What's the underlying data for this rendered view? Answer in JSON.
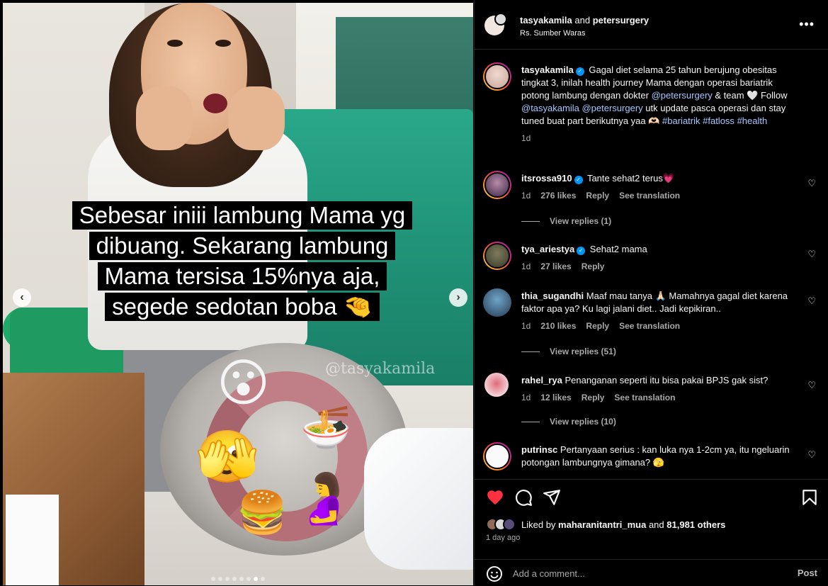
{
  "post": {
    "caption_lines": [
      "Sebesar iniii lambung Mama yg",
      "dibuang. Sekarang lambung",
      "Mama tersisa 15%nya aja,",
      "segede sedotan boba 🤏"
    ],
    "watermark": "@tasyakamila",
    "carousel": {
      "dot_count": 8,
      "active_index": 6
    },
    "emoji": {
      "surprised": "😮",
      "hiding": "🫣",
      "noodles": "🍜",
      "burger": "🍔",
      "pregnant": "🤰"
    }
  },
  "header": {
    "user1": "tasyakamila",
    "and_text": "and",
    "user2": "petersurgery",
    "location": "Rs. Sumber Waras",
    "more_icon": "more-horizontal-icon",
    "more_label": "•••"
  },
  "caption": {
    "username": "tasyakamila",
    "verified": true,
    "text_1": "Gagal diet selama 25 tahun berujung obesitas tingkat 3, inilah health journey Mama dengan operasi bariatrik potong lambung dengan dokter ",
    "mention_1": "@petersurgery",
    "text_2": " & team 🤍 Follow ",
    "mention_2": "@tasyakamila",
    "mention_3": "@petersurgery",
    "text_3": " utk update pasca operasi dan stay tuned buat part berikutnya yaa 🫶🏻 ",
    "hashtag_1": "#bariatrik",
    "hashtag_2": "#fatloss",
    "hashtag_3": "#health",
    "time": "1d"
  },
  "comments": [
    {
      "username": "itsrossa910",
      "verified": true,
      "text": "Tante sehat2 terus💗",
      "time": "1d",
      "likes": "276 likes",
      "reply": "Reply",
      "translate": "See translation",
      "view_replies": "View replies (1)"
    },
    {
      "username": "tya_ariestya",
      "verified": true,
      "text": "Sehat2 mama",
      "time": "1d",
      "likes": "27 likes",
      "reply": "Reply"
    },
    {
      "username": "thia_sugandhi",
      "verified": false,
      "text": "Maaf mau tanya 🙏🏻 Mamahnya gagal diet karena faktor apa ya? Ku lagi jalani diet.. Jadi kepikiran..",
      "time": "1d",
      "likes": "210 likes",
      "reply": "Reply",
      "translate": "See translation",
      "view_replies": "View replies (51)"
    },
    {
      "username": "rahel_rya",
      "verified": false,
      "text": "Penanganan seperti itu bisa pakai BPJS gak sist?",
      "time": "1d",
      "likes": "12 likes",
      "reply": "Reply",
      "translate": "See translation",
      "view_replies": "View replies (10)"
    },
    {
      "username": "putrinsc",
      "verified": false,
      "text": "Pertanyaan serius : kan luka nya 1-2cm ya, itu ngeluarin potongan lambungnya gimana? 🫣"
    }
  ],
  "actions": {
    "like_icon": "heart-filled-icon",
    "comment_icon": "comment-icon",
    "share_icon": "send-icon",
    "save_icon": "bookmark-icon",
    "liked_prefix": "Liked by",
    "liked_user": "maharanitantri_mua",
    "liked_and": "and",
    "liked_others": "81,981 others",
    "posted_ago": "1 day ago"
  },
  "add_comment": {
    "placeholder": "Add a comment...",
    "post_label": "Post",
    "emoji_icon": "smiley-icon"
  },
  "colors": {
    "background": "#000000",
    "text": "#f5f5f5",
    "muted": "#a8a8a8",
    "link": "#a8c7ff",
    "like_red": "#ff3040",
    "verified_blue": "#0095f6",
    "divider": "#262626"
  }
}
